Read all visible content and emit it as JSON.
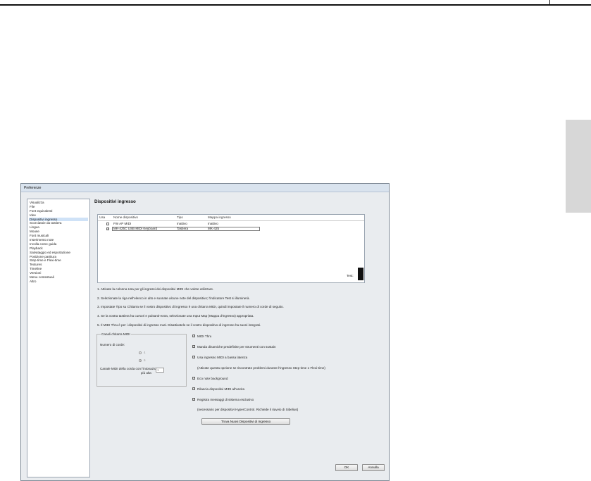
{
  "window": {
    "title": "Preferenze"
  },
  "nav": {
    "items": [
      "Visualizza",
      "File",
      "Font equivalenti",
      "Idee",
      "Dispositivi ingresso",
      "Scorciatoie da tastiera",
      "Lingua",
      "Mouse",
      "Font musicali",
      "Inserimento note",
      "Incolla come guida",
      "Playback",
      "Salvataggio ed esportazione",
      "Posizione partitura",
      "Step-time e Flexi-time",
      "Textures",
      "Timeline",
      "Versioni",
      "Menu contestuali",
      "Altro"
    ],
    "selected_index": 4
  },
  "panel": {
    "title": "Dispositivi ingresso",
    "list": {
      "headers": {
        "use": "Usa",
        "name": "Nome dispositivo",
        "type": "Tipo",
        "map": "Mappa ingresso"
      },
      "rows": [
        {
          "checked": false,
          "name": "FW AP MIDI",
          "type": "Inattivo",
          "map": "Inattivo"
        },
        {
          "checked": true,
          "name": "MK-425C USB MIDI Keyboard",
          "type": "Tastiera",
          "map": "MK-425"
        }
      ]
    },
    "test_label": "Test:",
    "instructions": [
      "1. Attivate la colonna Usa per gli ingressi dei dispositivi MIDI che volete utilizzare.",
      "2. Selezionate la riga nell'elenco in alto e suonate alcune note del dispositivo; l'indicatore Test si illuminerà.",
      "3. Impostate Tipo su Chitarra se il vostro dispositivo di ingresso è una chitarra MIDI, quindi impostate il numero di corde di seguito.",
      "4. Se la vostra tastiera ha cursori e pulsanti-extra, selezionate una Input Map (Mappa d'ingresso) appropriata.",
      "5. Il MIDI Thru è per i dispositivi di ingresso muti. Disattivatelo se il vostro dispositivo di ingresso ha suoni integrati."
    ],
    "guitar_group": {
      "title": "Canali chitarra MIDI",
      "strings_label": "Numero di corde:",
      "options": [
        "4",
        "6"
      ],
      "selected": "6",
      "channel_label_line1": "Canale MIDI della corda con l'intonazione",
      "channel_label_line2": "più alta",
      "channel_value": "1"
    },
    "options": [
      {
        "label": "MIDI Thru",
        "checked": true
      },
      {
        "label": "Manda dinamiche predefinite per strumenti con sustain",
        "checked": true
      },
      {
        "label": "Usa ingresso MIDI a bassa latenza",
        "checked": true
      },
      {
        "label": "Eco note background",
        "checked": true
      },
      {
        "label": "Rilascia dispositivi MIDI all'uscita",
        "checked": true
      },
      {
        "label": "Registra messaggi di sistema esclusivo",
        "checked": true
      }
    ],
    "latency_note": "(Attivate questa opzione se riscontrate problemi durante l'ingresso Step-time o Flexi-time)",
    "sysex_note": "(necessario per dispositivi HyperControl. Richiede il riavvio di Sibelius)",
    "find_button": "Trova Nuovi Dispositivi di Ingresso"
  },
  "buttons": {
    "ok": "OK",
    "cancel": "Annulla"
  }
}
